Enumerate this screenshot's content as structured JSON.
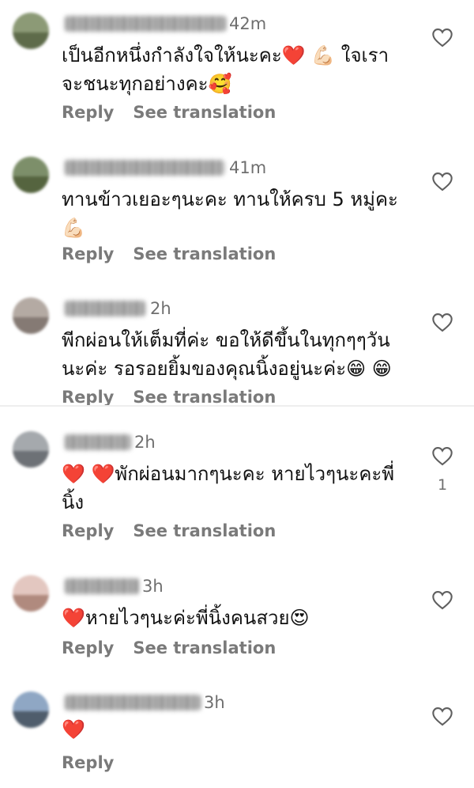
{
  "actions": {
    "reply_label": "Reply",
    "translate_label": "See translation"
  },
  "comments": [
    {
      "time": "42m",
      "text": "เป็นอีกหนึ่งกำลังใจให้นะคะ❤️ 💪🏻 ใจเรา\nจะชนะทุกอย่างคะ🥰",
      "likes": "",
      "avatar_colors": [
        "#8c9a76",
        "#5e6b4a"
      ]
    },
    {
      "time": "41m",
      "text": "ทานข้าวเยอะๆนะคะ ทานให้ครบ 5 หมู่คะ\n💪🏻",
      "likes": "",
      "avatar_colors": [
        "#7d8f6a",
        "#55643f"
      ]
    },
    {
      "time": "2h",
      "text": "พีกผ่อนให้เต็มที่ค่ะ ขอให้ดีขึ้นในทุกๆๆวัน\nนะค่ะ รอรอยยิ้มของคุณนิ้งอยู่นะค่ะ😁 😁",
      "likes": "",
      "avatar_colors": [
        "#b4aaa3",
        "#857a74"
      ]
    },
    {
      "time": "2h",
      "text": "❤️ ❤️พักผ่อนมากๆนะคะ หายไวๆนะคะพี่\nนิ้ง",
      "likes": "1",
      "avatar_colors": [
        "#a5a9ad",
        "#6d7176"
      ]
    },
    {
      "time": "3h",
      "text": "❤️หายไวๆนะค่ะพี่นิ้งคนสวย😍",
      "likes": "",
      "avatar_colors": [
        "#e3c7c0",
        "#b08a7e"
      ]
    },
    {
      "time": "3h",
      "text": "❤️",
      "likes": "",
      "avatar_colors": [
        "#8fa7c4",
        "#4f5d6c"
      ]
    }
  ]
}
